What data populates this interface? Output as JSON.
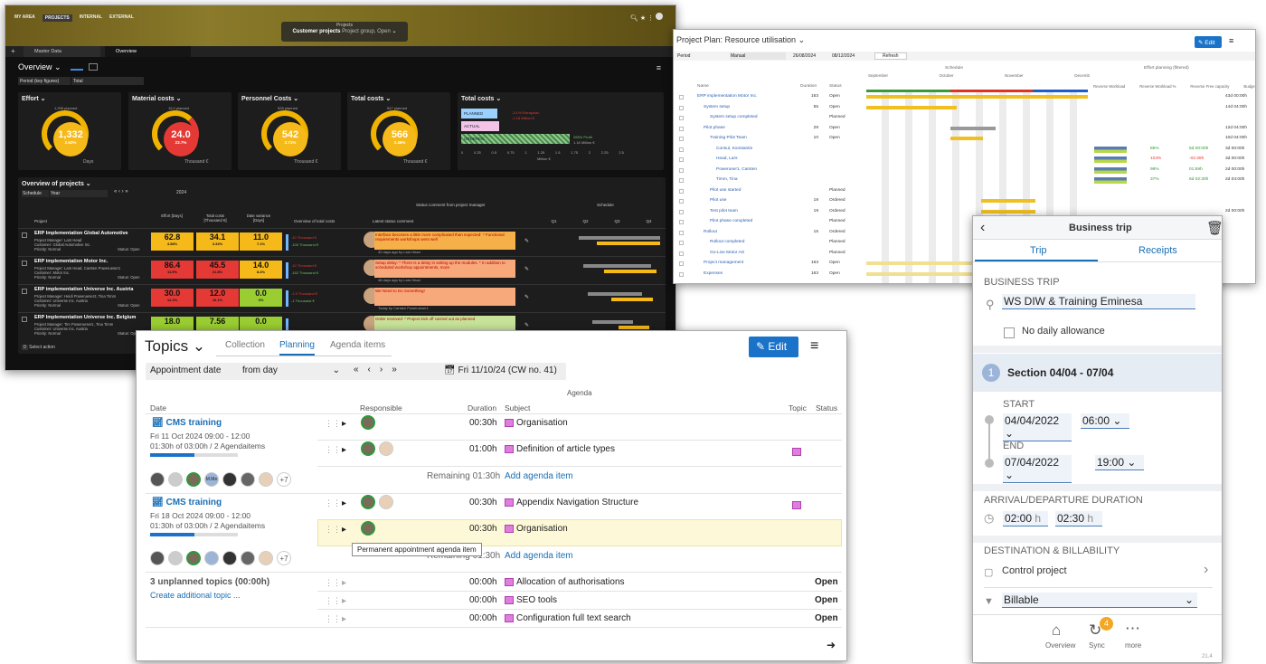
{
  "dashboard": {
    "nav": [
      "MY AREA",
      "PROJECTS",
      "INTERNAL",
      "EXTERNAL"
    ],
    "center_label": "Projects",
    "center_value": "Customer projects",
    "center_sub": "Project group, Open",
    "tabs": [
      "Master Data",
      "Overview"
    ],
    "view_title": "Overview",
    "period_label": "Period (key figures)",
    "period_value": "Total",
    "kpis": [
      {
        "title": "Effort",
        "planned": "1,298 planned",
        "value": "1,332",
        "pct": "2.62%",
        "unit": "Days",
        "color": "#f6b91a"
      },
      {
        "title": "Material costs",
        "planned": "19.4 planned",
        "value": "24.0",
        "pct": "23.7%",
        "unit": "Thousand €",
        "color": "#e53935"
      },
      {
        "title": "Personnel Costs",
        "planned": "528 planned",
        "value": "542",
        "pct": "2.71%",
        "unit": "Thousand €",
        "color": "#f6b91a"
      },
      {
        "title": "Total costs",
        "planned": "547 planned",
        "value": "566",
        "pct": "3.46%",
        "unit": "Thousand €",
        "color": "#f6b91a"
      }
    ],
    "total_costs": {
      "title": "Total costs",
      "rows": [
        "PLANNED",
        "ACTUAL",
        "ORDERED"
      ],
      "notes": [
        "-3.1% Extrapolat.",
        "-1.18 Million €",
        "265% Profit",
        "1.16 Million €"
      ],
      "ticks": [
        "0",
        "0.25",
        "0.5",
        "0.75",
        "1",
        "1.25",
        "1.5",
        "1.75",
        "2",
        "2.25",
        "2.5"
      ],
      "unit": "Million €"
    },
    "overview_title": "Overview of projects",
    "schedule_label": "Schedule",
    "schedule_value": "Year",
    "year": "2024",
    "cols": [
      "Project",
      "Effort [Days]",
      "Total costs [Thousand €]",
      "Date variance [Days]",
      "Overview of total costs",
      "Latest status comment",
      "Schedule"
    ],
    "status_header": "Status comment from project manager",
    "quarters": [
      "Q1",
      "Q2",
      "Q3",
      "Q4"
    ],
    "projects": [
      {
        "name": "ERP Implementation Global Automotive",
        "pm": "Project Manager: Lars Head",
        "cust": "Customer: Global Automotive Inc.",
        "prio": "Priority: Normal",
        "status": "Status: Open",
        "effort": "62.8",
        "ep": "4.58%",
        "cost": "34.1",
        "cp": "3.33%",
        "date": "11.0",
        "dp": "7.1%",
        "cmt": "Interface becomes a little more complicated than expected: * Functional requirements workshops went well",
        "when": "32 days ago by Lars Head",
        "bar1": "-10 Thousand €",
        "bar2": "-100 Thousand €"
      },
      {
        "name": "ERP implementation Motor Inc.",
        "pm": "Project Manager: Lars Head, Carsten Powerueser1",
        "cust": "Customer: Motor Inc.",
        "prio": "Priority: Normal",
        "status": "Status: Open",
        "effort": "86.4",
        "ep": "11.5%",
        "cost": "45.5",
        "cp": "21.8%",
        "date": "14.0",
        "dp": "8.4%",
        "cmt": "Setup delay: * There is a delay in setting up the modules. * In addition to scheduled workshop appointments, more",
        "when": "48 days ago by Lars Head",
        "bar1": "-10 Thousand €",
        "bar2": "-152 Thousand €"
      },
      {
        "name": "ERP implementation Universe Inc. Austria",
        "pm": "Project Manager: Heidi Powerueser2, Tina Timm",
        "cust": "Customer: Universe Inc. Austria",
        "prio": "Priority: Normal",
        "status": "Status: Open",
        "effort": "30.0",
        "ep": "12.2%",
        "cost": "12.0",
        "cp": "10.1%",
        "date": "0.0",
        "dp": "0%",
        "cmt": "We Need to Do Something!",
        "when": "Today by Carsten Powerueser1",
        "bar1": "-1.5 Thousand €",
        "bar2": "-1 Thousand €"
      },
      {
        "name": "ERP Implementation Universe Inc. Belgium",
        "pm": "Project Manager: Tim Powerueser1, Tina Timm",
        "cust": "Customer: Universe Inc. Austria",
        "prio": "Priority: Normal",
        "status": "Status: Open",
        "effort": "18.0",
        "ep": "",
        "cost": "7.56",
        "cp": "",
        "date": "0.0",
        "dp": "",
        "cmt": "Order received: * Project kick off carried out as planned",
        "when": "7 days ago by Tim Powerueser",
        "bar1": "",
        "bar2": ""
      }
    ],
    "footer_count": "0",
    "footer_action": "Select action"
  },
  "gantt": {
    "title": "Project Plan: Resource utilisation",
    "edit": "Edit",
    "period_label": "Period",
    "period_value": "Manual",
    "date_from": "26/08/2024",
    "date_to": "08/12/2024",
    "refresh": "Refresh",
    "cols": [
      "Name",
      "Duration",
      "Status"
    ],
    "schedule": "Schedule",
    "effort_hdr": "Effort planning (filtered)",
    "months": [
      "September",
      "October",
      "November",
      "Decemb"
    ],
    "effort_cols": [
      "Reverse Workload",
      "Reverse Workload %",
      "Reverse Free capacity",
      "Budget"
    ],
    "rows": [
      {
        "name": "ERP implementation Motor Inc.",
        "dur": "163",
        "st": "Open",
        "r": "43d 00:00h"
      },
      {
        "name": "System setup",
        "dur": "55",
        "st": "Open",
        "r": "14d 04:00h"
      },
      {
        "name": "System setup completed",
        "dur": "",
        "st": "Planned",
        "r": ""
      },
      {
        "name": "Pilot phase",
        "dur": "29",
        "st": "Open",
        "r": "12d 04:00h"
      },
      {
        "name": "Training Pilot Team",
        "dur": "10",
        "st": "Open",
        "r": "10d 04:00h"
      },
      {
        "name": "Consul, Konstantin",
        "dur": "",
        "st": "",
        "r": "3d 00:00h",
        "pct": "85%",
        "fc": "5d 00:00h"
      },
      {
        "name": "Head, Lars",
        "dur": "",
        "st": "",
        "r": "3d 00:00h",
        "pct": "103%",
        "fc": "-02:39h"
      },
      {
        "name": "Poweruser1, Carsten",
        "dur": "",
        "st": "",
        "r": "2d 00:00h",
        "pct": "98%",
        "fc": "01:59h"
      },
      {
        "name": "Timm, Tina",
        "dur": "",
        "st": "",
        "r": "2d 04:00h",
        "pct": "37%",
        "fc": "6d 02:30h"
      },
      {
        "name": "Pilot use started",
        "dur": "",
        "st": "Planned",
        "r": ""
      },
      {
        "name": "Pilot use",
        "dur": "19",
        "st": "Ordered",
        "r": ""
      },
      {
        "name": "Test pilot team",
        "dur": "19",
        "st": "Ordered",
        "r": "2d 00:00h"
      },
      {
        "name": "Pilot phase completed",
        "dur": "",
        "st": "Planned",
        "r": ""
      },
      {
        "name": "Rollout",
        "dur": "15",
        "st": "Ordered",
        "r": ""
      },
      {
        "name": "Rollout completed",
        "dur": "",
        "st": "Planned",
        "r": ""
      },
      {
        "name": "Go-Live Motor AG",
        "dur": "",
        "st": "Planned",
        "r": ""
      },
      {
        "name": "Project management",
        "dur": "163",
        "st": "Open",
        "r": ""
      },
      {
        "name": "Expenses",
        "dur": "163",
        "st": "Open",
        "r": ""
      }
    ]
  },
  "topics": {
    "title": "Topics",
    "tabs": [
      "Collection",
      "Planning",
      "Agenda items"
    ],
    "edit": "Edit",
    "appt_label": "Appointment date",
    "from_label": "from day",
    "date": "Fri 11/10/24 (CW no. 41)",
    "agenda": "Agenda",
    "cols": [
      "Date",
      "Responsible",
      "Duration",
      "Subject",
      "Topic",
      "Status"
    ],
    "m1": {
      "title": "CMS training",
      "date": "Fri 11 Oct 2024 09:00 - 12:00",
      "dur": "01:30h of 03:00h / 2 Agendaitems"
    },
    "m2": {
      "title": "CMS training",
      "date": "Fri 18 Oct 2024 09:00 - 12:00",
      "dur": "01:30h of 03:00h / 2 Agendaitems"
    },
    "items1": [
      {
        "d": "00:30h",
        "s": "Organisation"
      },
      {
        "d": "01:00h",
        "s": "Definition of article types"
      }
    ],
    "remaining1": "Remaining 01:30h",
    "add": "Add agenda item",
    "items2": [
      {
        "d": "00:30h",
        "s": "Appendix Navigation Structure"
      },
      {
        "d": "00:30h",
        "s": "Organisation"
      }
    ],
    "remaining2": "Remaining 01:30h",
    "tooltip": "Permanent appointment agenda item",
    "more": "+7",
    "initials": "M.Me",
    "unplanned": "3 unplanned topics (00:00h)",
    "create": "Create additional topic ...",
    "items3": [
      {
        "d": "00:00h",
        "s": "Allocation of authorisations",
        "st": "Open"
      },
      {
        "d": "00:00h",
        "s": "SEO tools",
        "st": "Open"
      },
      {
        "d": "00:00h",
        "s": "Configuration full text search",
        "st": "Open"
      }
    ]
  },
  "mobile": {
    "title": "Business trip",
    "tabs": [
      "Trip",
      "Receipts"
    ],
    "section_trip": "BUSINESS TRIP",
    "trip_name": "WS DIW & Training Eminesa",
    "no_allowance": "No daily allowance",
    "section_num": "1",
    "section": "Section 04/04 - 07/04",
    "start": "START",
    "start_date": "04/04/2022",
    "start_time": "06:00",
    "end": "END",
    "end_date": "07/04/2022",
    "end_time": "19:00",
    "arrival": "ARRIVAL/DEPARTURE DURATION",
    "arr": "02:00",
    "dep": "02:30",
    "h": "h",
    "dest": "DESTINATION & BILLABILITY",
    "control": "Control project",
    "billable": "Billable",
    "nav": [
      "Overview",
      "Sync",
      "more"
    ],
    "badge": "4",
    "version": "21.4"
  }
}
